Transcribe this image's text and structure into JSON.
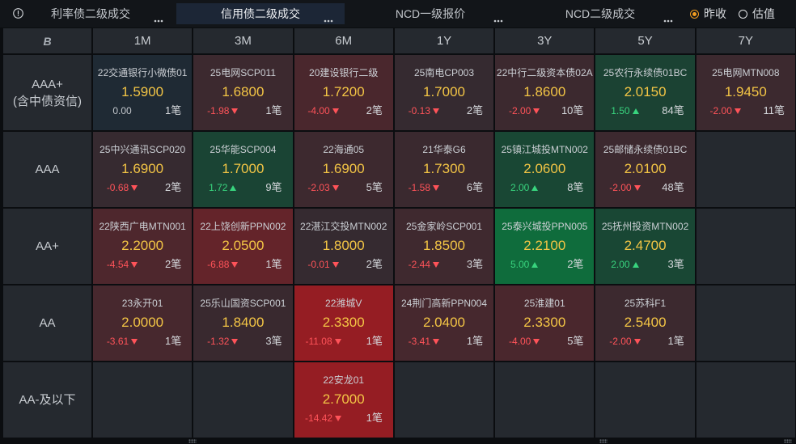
{
  "tabs": [
    {
      "label": "利率债二级成交",
      "active": false
    },
    {
      "label": "信用债二级成交",
      "active": true
    },
    {
      "label": "NCD一级报价",
      "active": false
    },
    {
      "label": "NCD二级成交",
      "active": false
    }
  ],
  "icons": {
    "first_tab": "alert-circle-icon",
    "tab_menu": "more-icon",
    "rise": "up-arrow-icon",
    "fall": "down-arrow-icon",
    "grip": "drag-handle-icon"
  },
  "basis_options": [
    {
      "label": "昨收",
      "selected": true
    },
    {
      "label": "估值",
      "selected": false
    }
  ],
  "grid": {
    "corner_logo": "B",
    "tenors": [
      "1M",
      "3M",
      "6M",
      "1Y",
      "3Y",
      "5Y",
      "7Y"
    ],
    "rows": [
      {
        "rating": "AAA+",
        "rating_note": "(含中债资信)",
        "cells": [
          {
            "bond": "22交通银行小微债01",
            "yield": "1.5900",
            "change": "0.00",
            "trades": "1笔"
          },
          {
            "bond": "25电网SCP011",
            "yield": "1.6800",
            "change": "-1.98",
            "trades": "1笔"
          },
          {
            "bond": "20建设银行二级",
            "yield": "1.7200",
            "change": "-4.00",
            "trades": "2笔"
          },
          {
            "bond": "25南电CP003",
            "yield": "1.7000",
            "change": "-0.13",
            "trades": "2笔"
          },
          {
            "bond": "22中行二级资本债02A",
            "yield": "1.8600",
            "change": "-2.00",
            "trades": "10笔"
          },
          {
            "bond": "25农行永续债01BC",
            "yield": "2.0150",
            "change": "1.50",
            "trades": "84笔"
          },
          {
            "bond": "25电网MTN008",
            "yield": "1.9450",
            "change": "-2.00",
            "trades": "11笔"
          }
        ]
      },
      {
        "rating": "AAA",
        "cells": [
          {
            "bond": "25中兴通讯SCP020",
            "yield": "1.6900",
            "change": "-0.68",
            "trades": "2笔"
          },
          {
            "bond": "25华能SCP004",
            "yield": "1.7000",
            "change": "1.72",
            "trades": "9笔"
          },
          {
            "bond": "22海通05",
            "yield": "1.6900",
            "change": "-2.03",
            "trades": "5笔"
          },
          {
            "bond": "21华泰G6",
            "yield": "1.7300",
            "change": "-1.58",
            "trades": "6笔"
          },
          {
            "bond": "25镇江城投MTN002",
            "yield": "2.0600",
            "change": "2.00",
            "trades": "8笔"
          },
          {
            "bond": "25邮储永续债01BC",
            "yield": "2.0100",
            "change": "-2.00",
            "trades": "48笔"
          },
          null
        ]
      },
      {
        "rating": "AA+",
        "cells": [
          {
            "bond": "22陕西广电MTN001",
            "yield": "2.2000",
            "change": "-4.54",
            "trades": "2笔"
          },
          {
            "bond": "22上饶创新PPN002",
            "yield": "2.0500",
            "change": "-6.88",
            "trades": "1笔"
          },
          {
            "bond": "22湛江交投MTN002",
            "yield": "1.8000",
            "change": "-0.01",
            "trades": "2笔"
          },
          {
            "bond": "25金家岭SCP001",
            "yield": "1.8500",
            "change": "-2.44",
            "trades": "3笔"
          },
          {
            "bond": "25泰兴城投PPN005",
            "yield": "2.2100",
            "change": "5.00",
            "trades": "2笔"
          },
          {
            "bond": "25抚州投资MTN002",
            "yield": "2.4700",
            "change": "2.00",
            "trades": "3笔"
          },
          null
        ]
      },
      {
        "rating": "AA",
        "cells": [
          {
            "bond": "23永开01",
            "yield": "2.0000",
            "change": "-3.61",
            "trades": "1笔"
          },
          {
            "bond": "25乐山国资SCP001",
            "yield": "1.8400",
            "change": "-1.32",
            "trades": "3笔"
          },
          {
            "bond": "22潍城V",
            "yield": "2.3300",
            "change": "-11.08",
            "trades": "1笔"
          },
          {
            "bond": "24荆门高新PPN004",
            "yield": "2.0400",
            "change": "-3.41",
            "trades": "1笔"
          },
          {
            "bond": "25淮建01",
            "yield": "2.3300",
            "change": "-4.00",
            "trades": "5笔"
          },
          {
            "bond": "25苏科F1",
            "yield": "2.5400",
            "change": "-2.00",
            "trades": "1笔"
          },
          null
        ]
      },
      {
        "rating": "AA-及以下",
        "cells": [
          null,
          null,
          {
            "bond": "22安龙01",
            "yield": "2.7000",
            "change": "-14.42",
            "trades": "1笔"
          },
          null,
          null,
          null,
          null
        ]
      }
    ]
  },
  "colors": {
    "yield_text": "#f3c545",
    "change_down": "#ff5359",
    "change_up": "#38d47e",
    "change_flat": "#c3c7cc",
    "heat_neutral": "#1f2a34",
    "heat_neg_low": "#352a30",
    "heat_neg_high": "#951d23",
    "heat_pos_low": "#1e3731",
    "heat_pos_high": "#0f6c3c",
    "active_tab": "#1c2636",
    "radio_selected": "#f29d20"
  }
}
